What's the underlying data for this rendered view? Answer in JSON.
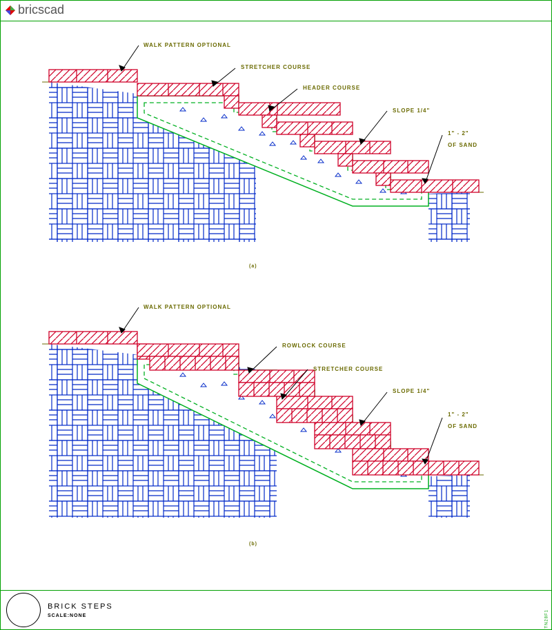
{
  "logo": {
    "text": "bricscad"
  },
  "detail_a": {
    "labels": {
      "walk": "WALK PATTERN OPTIONAL",
      "stretcher": "STRETCHER COURSE",
      "header": "HEADER COURSE",
      "slope": "SLOPE 1/4\"",
      "sand1": "1\" - 2\"",
      "sand2": "OF SAND"
    },
    "caption": "(a)"
  },
  "detail_b": {
    "labels": {
      "walk": "WALK PATTERN OPTIONAL",
      "rowlock": "ROWLOCK COURSE",
      "stretcher": "STRETCHER COURSE",
      "slope": "SLOPE 1/4\"",
      "sand1": "1\" - 2\"",
      "sand2": "OF SAND"
    },
    "caption": "(b)"
  },
  "title": {
    "main": "BRICK STEPS",
    "scale": "SCALE:NONE"
  },
  "sidetext": "TN28F1"
}
